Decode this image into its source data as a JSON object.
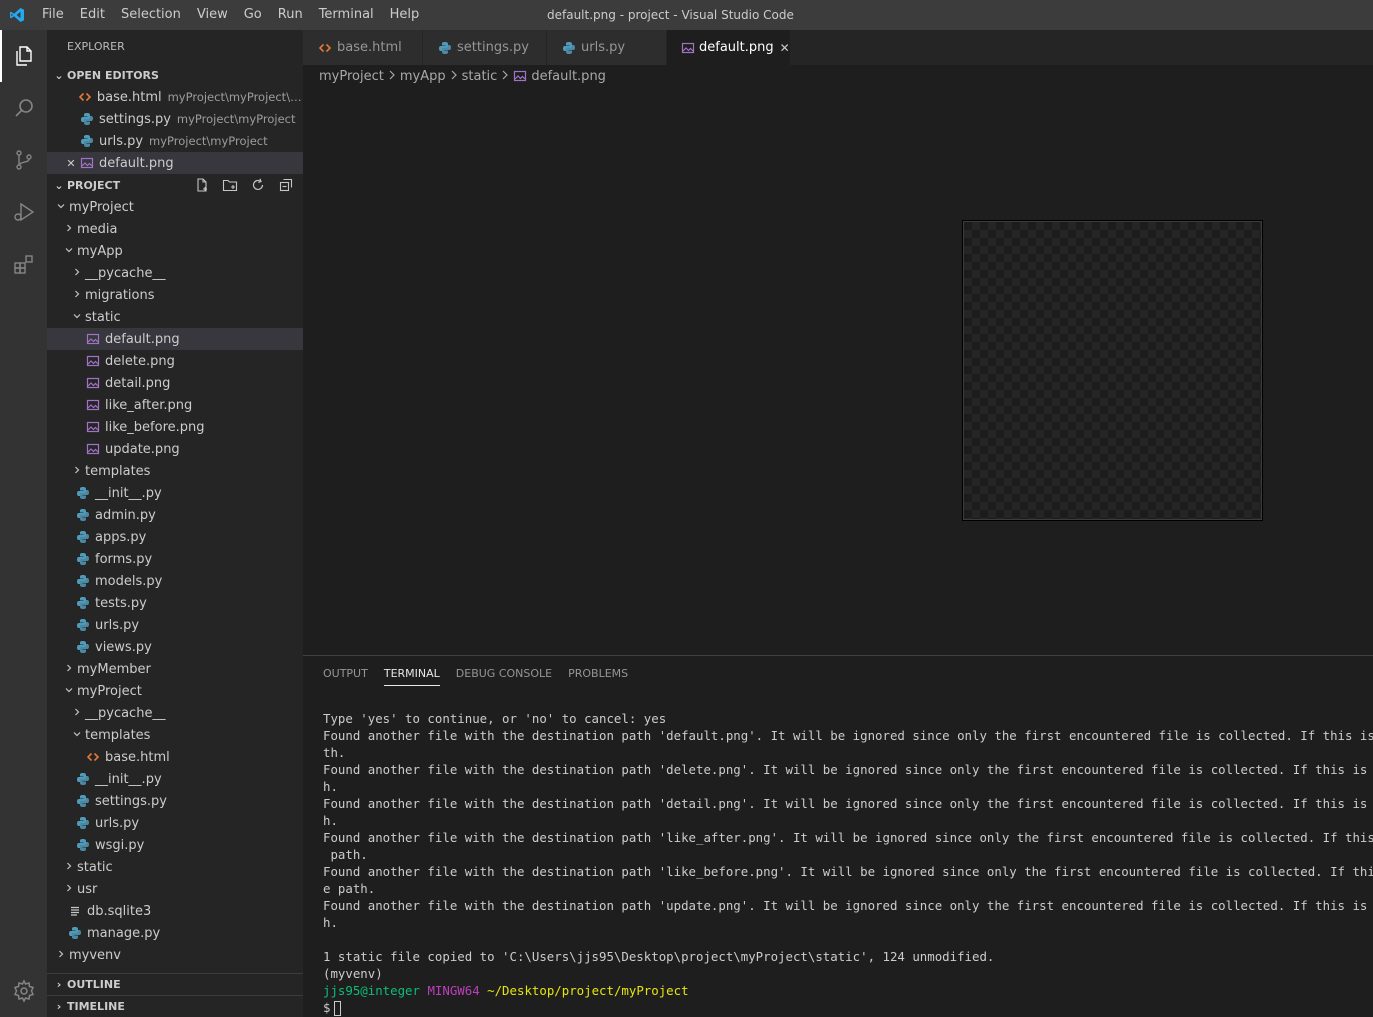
{
  "titlebar": {
    "menu": [
      "File",
      "Edit",
      "Selection",
      "View",
      "Go",
      "Run",
      "Terminal",
      "Help"
    ],
    "title": "default.png - project - Visual Studio Code"
  },
  "activity": {
    "icons": [
      "files-icon",
      "search-icon",
      "source-control-icon",
      "run-debug-icon",
      "extensions-icon"
    ],
    "gear": "gear-icon"
  },
  "sidebar": {
    "header": "EXPLORER",
    "open_editors": {
      "title": "OPEN EDITORS",
      "items": [
        {
          "name": "base.html",
          "desc": "myProject\\myProject\\te...",
          "icon": "html"
        },
        {
          "name": "settings.py",
          "desc": "myProject\\myProject",
          "icon": "python"
        },
        {
          "name": "urls.py",
          "desc": "myProject\\myProject",
          "icon": "python"
        },
        {
          "name": "default.png",
          "desc": "",
          "icon": "image"
        }
      ]
    },
    "project": {
      "title": "PROJECT",
      "tree": [
        {
          "label": "myProject",
          "depth": 0,
          "type": "folder",
          "open": true
        },
        {
          "label": "media",
          "depth": 1,
          "type": "folder",
          "open": false
        },
        {
          "label": "myApp",
          "depth": 1,
          "type": "folder",
          "open": true
        },
        {
          "label": "__pycache__",
          "depth": 2,
          "type": "folder",
          "open": false
        },
        {
          "label": "migrations",
          "depth": 2,
          "type": "folder",
          "open": false
        },
        {
          "label": "static",
          "depth": 2,
          "type": "folder",
          "open": true
        },
        {
          "label": "default.png",
          "depth": 3,
          "type": "image",
          "selected": true
        },
        {
          "label": "delete.png",
          "depth": 3,
          "type": "image"
        },
        {
          "label": "detail.png",
          "depth": 3,
          "type": "image"
        },
        {
          "label": "like_after.png",
          "depth": 3,
          "type": "image"
        },
        {
          "label": "like_before.png",
          "depth": 3,
          "type": "image"
        },
        {
          "label": "update.png",
          "depth": 3,
          "type": "image"
        },
        {
          "label": "templates",
          "depth": 2,
          "type": "folder",
          "open": false
        },
        {
          "label": "__init__.py",
          "depth": 2,
          "type": "python"
        },
        {
          "label": "admin.py",
          "depth": 2,
          "type": "python"
        },
        {
          "label": "apps.py",
          "depth": 2,
          "type": "python"
        },
        {
          "label": "forms.py",
          "depth": 2,
          "type": "python"
        },
        {
          "label": "models.py",
          "depth": 2,
          "type": "python"
        },
        {
          "label": "tests.py",
          "depth": 2,
          "type": "python"
        },
        {
          "label": "urls.py",
          "depth": 2,
          "type": "python"
        },
        {
          "label": "views.py",
          "depth": 2,
          "type": "python"
        },
        {
          "label": "myMember",
          "depth": 1,
          "type": "folder",
          "open": false
        },
        {
          "label": "myProject",
          "depth": 1,
          "type": "folder",
          "open": true
        },
        {
          "label": "__pycache__",
          "depth": 2,
          "type": "folder",
          "open": false
        },
        {
          "label": "templates",
          "depth": 2,
          "type": "folder",
          "open": true
        },
        {
          "label": "base.html",
          "depth": 3,
          "type": "html"
        },
        {
          "label": "__init__.py",
          "depth": 2,
          "type": "python"
        },
        {
          "label": "settings.py",
          "depth": 2,
          "type": "python"
        },
        {
          "label": "urls.py",
          "depth": 2,
          "type": "python"
        },
        {
          "label": "wsgi.py",
          "depth": 2,
          "type": "python"
        },
        {
          "label": "static",
          "depth": 1,
          "type": "folder",
          "open": false
        },
        {
          "label": "usr",
          "depth": 1,
          "type": "folder",
          "open": false
        },
        {
          "label": "db.sqlite3",
          "depth": 1,
          "type": "db"
        },
        {
          "label": "manage.py",
          "depth": 1,
          "type": "python"
        },
        {
          "label": "myvenv",
          "depth": 0,
          "type": "folder",
          "open": false
        }
      ]
    },
    "outline": "OUTLINE",
    "timeline": "TIMELINE"
  },
  "tabs": [
    {
      "label": "base.html",
      "icon": "html",
      "active": false
    },
    {
      "label": "settings.py",
      "icon": "python",
      "active": false
    },
    {
      "label": "urls.py",
      "icon": "python",
      "active": false
    },
    {
      "label": "default.png",
      "icon": "image",
      "active": true
    }
  ],
  "breadcrumb": [
    "myProject",
    "myApp",
    "static",
    "default.png"
  ],
  "panel": {
    "tabs": [
      "OUTPUT",
      "TERMINAL",
      "DEBUG CONSOLE",
      "PROBLEMS"
    ],
    "active_tab": "TERMINAL",
    "terminal_lines": [
      "Type 'yes' to continue, or 'no' to cancel: yes",
      "Found another file with the destination path 'default.png'. It will be ignored since only the first encountered file is collected. If this is not what",
      "th.",
      "Found another file with the destination path 'delete.png'. It will be ignored since only the first encountered file is collected. If this is not what",
      "h.",
      "Found another file with the destination path 'detail.png'. It will be ignored since only the first encountered file is collected. If this is not what",
      "h.",
      "Found another file with the destination path 'like_after.png'. It will be ignored since only the first encountered file is collected. If this is not w",
      " path.",
      "Found another file with the destination path 'like_before.png'. It will be ignored since only the first encountered file is collected. If this is not",
      "e path.",
      "Found another file with the destination path 'update.png'. It will be ignored since only the first encountered file is collected. If this is not what",
      "h.",
      "",
      "1 static file copied to 'C:\\Users\\jjs95\\Desktop\\project\\myProject\\static', 124 unmodified.",
      "(myvenv)"
    ],
    "prompt": {
      "user": "jjs95@integer",
      "shell": "MINGW64",
      "path": "~/Desktop/project/myProject",
      "symbol": "$"
    }
  },
  "colors": {
    "accent": "#007acc",
    "python_icon": "#519aba",
    "html_icon": "#e37933",
    "image_icon": "#a074c4"
  }
}
